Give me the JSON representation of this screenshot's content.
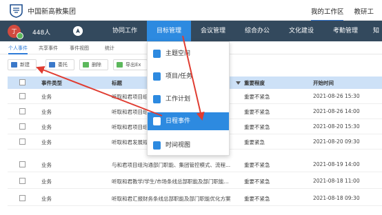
{
  "header": {
    "org_name": "中国新高教集团",
    "right_tabs": [
      "我的工作区",
      "教研工"
    ]
  },
  "navbar": {
    "avatar_text": "丁",
    "user_count": "448人",
    "items": [
      "协同工作",
      "目标管理",
      "会议管理",
      "综合办公",
      "文化建设",
      "考勤管理",
      "知"
    ],
    "active_index": 1
  },
  "subtabs": [
    "个人事件",
    "共享事件",
    "事件视图",
    "统计"
  ],
  "toolbar": {
    "new": "新建",
    "delegate": "委托",
    "delete": "删除",
    "export": "导出Ex"
  },
  "table": {
    "headers": [
      "事件类型",
      "标题",
      "重要程度",
      "开始时间"
    ],
    "rows": [
      {
        "type": "业务",
        "title": "听取和君项目组",
        "importance": "重要不紧急",
        "start": "2021-08-26 15:30"
      },
      {
        "type": "业务",
        "title": "听取和君项目组",
        "importance": "重要不紧急",
        "start": "2021-08-26 14:00"
      },
      {
        "type": "业务",
        "title": "听取和君项目组",
        "importance": "重要不紧急",
        "start": "2021-08-20 15:30"
      },
      {
        "type": "业务",
        "title": "听取和君发展规",
        "importance": "重要紧急",
        "start": "2021-08-20 09:30"
      },
      {
        "type": "业务",
        "title": "与和君项目组沟通部门职能、集团管控模式、流程...",
        "importance": "重要不紧急",
        "start": "2021-08-19 14:00"
      },
      {
        "type": "业务",
        "title": "听取和君教学/学生/市场条线总部职能及部门职能...",
        "importance": "重要不紧急",
        "start": "2021-08-18 11:00"
      },
      {
        "type": "业务",
        "title": "听取和君汇报财务条线总部职能及部门职能优化方案",
        "importance": "重要不紧急",
        "start": "2021-08-18 09:30"
      }
    ]
  },
  "dropdown": {
    "items": [
      "主题空间",
      "项目/任务",
      "工作计划",
      "日程事件",
      "时间视图"
    ],
    "active_index": 3
  },
  "colors": {
    "nav_bg": "#33495d",
    "accent": "#2d8ae0",
    "header_row": "#cde1f7",
    "arrow": "#e03c31"
  }
}
